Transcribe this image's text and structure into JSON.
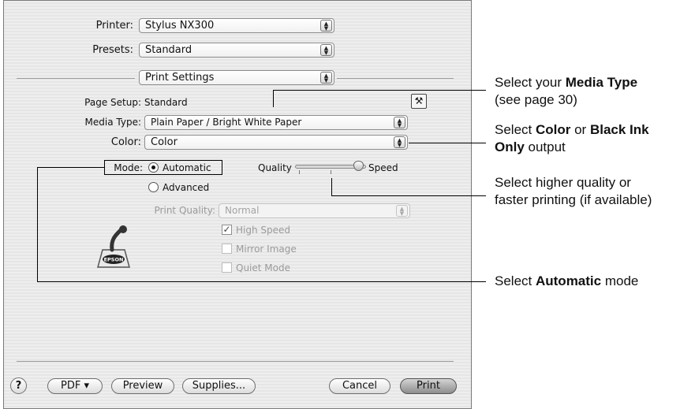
{
  "dialog": {
    "printer": {
      "label": "Printer:",
      "value": "Stylus NX300"
    },
    "presets": {
      "label": "Presets:",
      "value": "Standard"
    },
    "panel_popup": {
      "value": "Print Settings"
    },
    "page_setup": {
      "label": "Page Setup:",
      "value": "Standard"
    },
    "media_type": {
      "label": "Media Type:",
      "value": "Plain Paper / Bright White Paper"
    },
    "color": {
      "label": "Color:",
      "value": "Color"
    },
    "mode": {
      "label": "Mode:",
      "automatic": "Automatic",
      "advanced": "Advanced",
      "selected": "Automatic"
    },
    "quality_slider": {
      "left_label": "Quality",
      "right_label": "Speed",
      "level": 1.0
    },
    "print_quality": {
      "label": "Print Quality:",
      "value": "Normal"
    },
    "options": [
      {
        "label": "High Speed",
        "checked": true
      },
      {
        "label": "Mirror Image",
        "checked": false
      },
      {
        "label": "Quiet Mode",
        "checked": false
      }
    ],
    "epson_logo_text": "EPSON",
    "buttons": {
      "help": "?",
      "pdf": "PDF ▾",
      "preview": "Preview",
      "supplies": "Supplies...",
      "cancel": "Cancel",
      "print": "Print"
    }
  },
  "callouts": {
    "media": {
      "pre": "Select your ",
      "bold": "Media Type",
      "line2": "(see page 30)"
    },
    "color": {
      "pre": "Select ",
      "bold1": "Color",
      "mid": " or ",
      "bold2": "Black Ink",
      "bold3": "Only",
      "post": " output"
    },
    "quality": {
      "line1": "Select higher quality or",
      "line2": "faster printing (if available)"
    },
    "mode": {
      "pre": "Select ",
      "bold": "Automatic",
      "post": " mode"
    }
  }
}
